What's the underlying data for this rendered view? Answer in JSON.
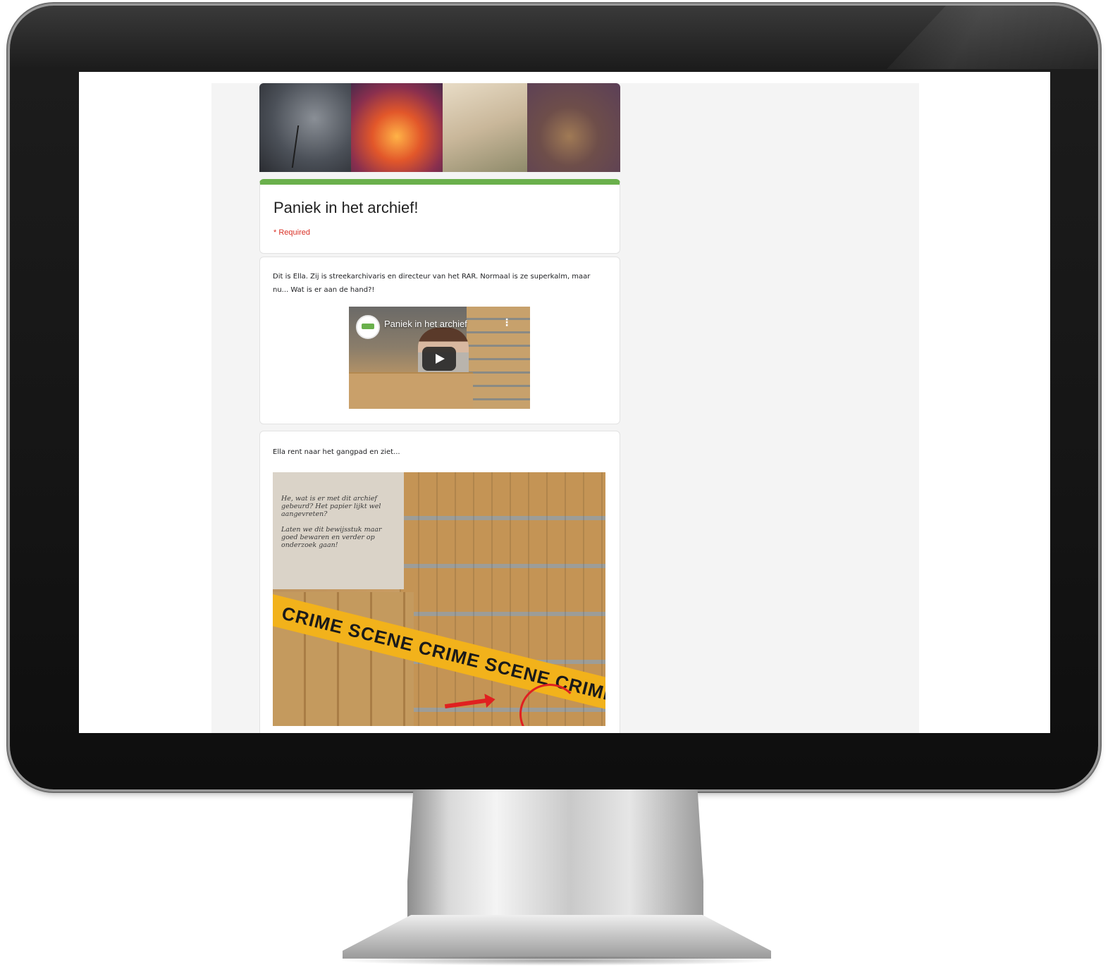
{
  "form": {
    "title": "Paniek in het archief!",
    "required_note": "* Required"
  },
  "intro_card": {
    "text": "Dit is Ella. Zij is streekarchivaris en directeur van het RAR. Normaal is ze superkalm, maar nu... Wat is er aan de hand?!",
    "video": {
      "title": "Paniek in het archief",
      "menu_icon": "more-vert-icon",
      "play_icon": "play-icon"
    }
  },
  "image_card": {
    "text": "Ella rent naar het gangpad en ziet...",
    "image": {
      "note_text": "He, wat is er met dit archief gebeurd? Het papier lijkt wel aangevreten?\n\nLaten we dit bewijsstuk maar goed bewaren en verder op onderzoek gaan!",
      "tape_text": "CRIME SCENE   CRIME SCENE   CRIME SCENE"
    }
  },
  "colors": {
    "accent_green": "#6ab04c",
    "required_red": "#d93025",
    "page_background": "#f4f4f4"
  }
}
